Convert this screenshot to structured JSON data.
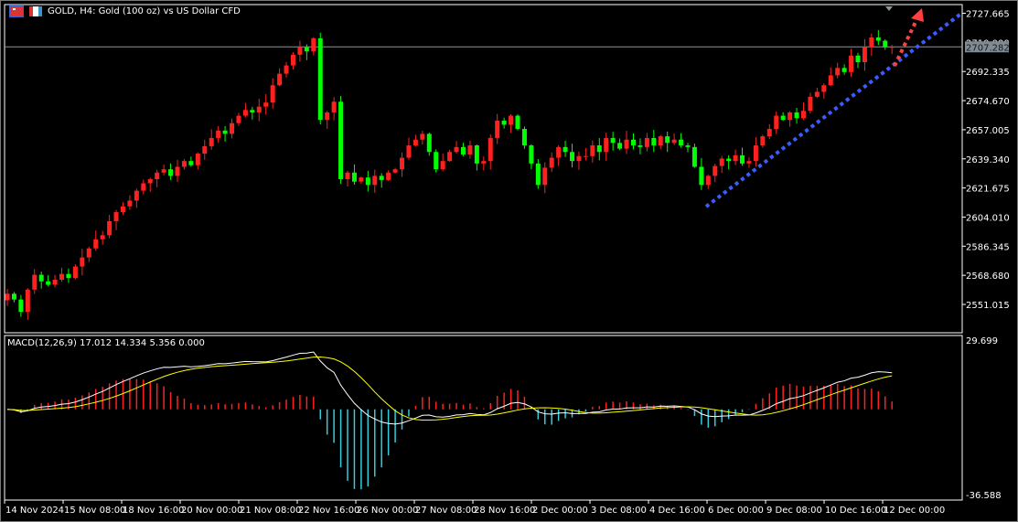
{
  "header": {
    "title": "GOLD, H4:  Gold (100 oz) vs US Dollar CFD",
    "icons": [
      "chart-list-icon",
      "chart-type-icon"
    ]
  },
  "current_price": "2707.282",
  "hidden_grid_label": "2710.000",
  "macd": {
    "label": "MACD(12,26,9) 17.012 14.334 5.356 0.000",
    "axis_top": "29.699",
    "axis_bottom": "-36.588",
    "range": [
      -36.588,
      29.699
    ]
  },
  "colors": {
    "bull": "#ff2020",
    "bear": "#00ff00",
    "trendline": "#3a5cff",
    "arrow": "#ff4040",
    "macd_line": "#ffffff",
    "signal_line": "#ffff00",
    "hist_pos": "#ff2020",
    "hist_neg": "#33ccdd"
  },
  "chart_data": {
    "type": "candlestick",
    "symbol": "GOLD",
    "timeframe": "H4",
    "ylim": [
      2551.015,
      2727.665
    ],
    "y_ticks": [
      "2727.665",
      "2692.335",
      "2674.670",
      "2657.005",
      "2639.340",
      "2621.675",
      "2604.010",
      "2586.345",
      "2568.680",
      "2551.015"
    ],
    "x_ticks": [
      "14 Nov 2024",
      "15 Nov 08:00",
      "18 Nov 16:00",
      "20 Nov 00:00",
      "21 Nov 08:00",
      "22 Nov 16:00",
      "26 Nov 00:00",
      "27 Nov 08:00",
      "28 Nov 16:00",
      "2 Dec 00:00",
      "3 Dec 08:00",
      "4 Dec 16:00",
      "6 Dec 00:00",
      "9 Dec 08:00",
      "10 Dec 16:00",
      "12 Dec 00:00"
    ],
    "closes": [
      2557.5,
      2554,
      2546.5,
      2560,
      2569,
      2565,
      2563,
      2566,
      2569.5,
      2567,
      2574,
      2579.5,
      2585,
      2590.5,
      2593,
      2601.5,
      2607,
      2610.5,
      2614,
      2620,
      2624.5,
      2627,
      2631,
      2633,
      2629,
      2634.5,
      2638,
      2635.5,
      2642.5,
      2647,
      2652,
      2656.5,
      2654.5,
      2661,
      2665.5,
      2669,
      2667.5,
      2671,
      2673.5,
      2684,
      2691,
      2696,
      2702.5,
      2707,
      2704.5,
      2712.5,
      2663,
      2667.5,
      2674,
      2627,
      2631,
      2625.5,
      2628,
      2623.5,
      2629,
      2626.5,
      2631,
      2633,
      2640,
      2647.5,
      2651,
      2654.5,
      2643.5,
      2633,
      2638,
      2643.5,
      2646.5,
      2642,
      2647.5,
      2636.5,
      2638,
      2652,
      2662.5,
      2660,
      2665.5,
      2657.5,
      2647.5,
      2636.5,
      2623.5,
      2634,
      2640,
      2646.5,
      2643.5,
      2638,
      2641,
      2641,
      2647.5,
      2643.5,
      2652,
      2649,
      2645.5,
      2651,
      2647.5,
      2646.5,
      2652,
      2647.5,
      2653,
      2649,
      2651,
      2647.5,
      2646.5,
      2634.5,
      2623.5,
      2629,
      2635,
      2639.5,
      2638,
      2641.5,
      2636.5,
      2638,
      2647.5,
      2653,
      2657.5,
      2665.5,
      2663,
      2667.5,
      2664,
      2668.5,
      2677,
      2680,
      2684,
      2690,
      2694.5,
      2692,
      2702,
      2698,
      2707,
      2713,
      2711,
      2707,
      2707.282
    ],
    "annotations": [
      "ascending-trendline",
      "dotted-arrow-up"
    ]
  }
}
